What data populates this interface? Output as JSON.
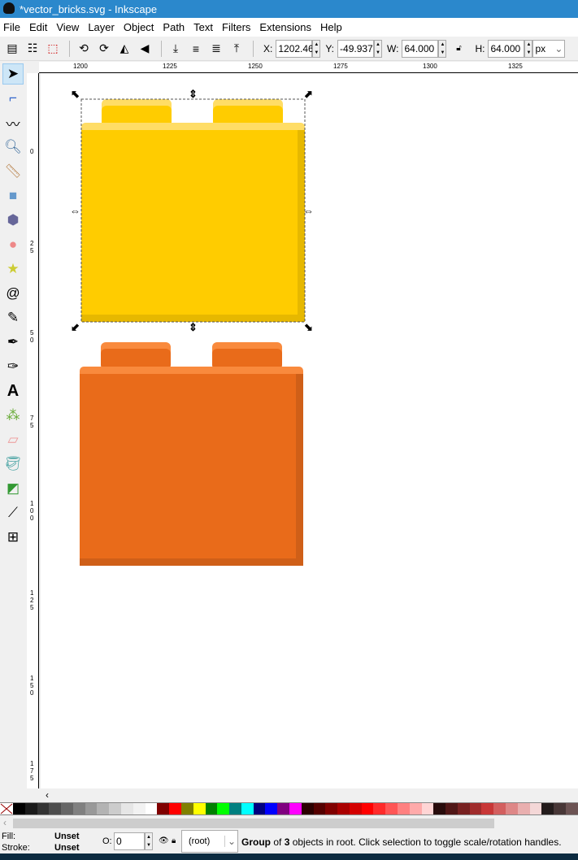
{
  "window": {
    "title": "*vector_bricks.svg - Inkscape"
  },
  "menu": [
    "File",
    "Edit",
    "View",
    "Layer",
    "Object",
    "Path",
    "Text",
    "Filters",
    "Extensions",
    "Help"
  ],
  "toolbar": {
    "x_label": "X:",
    "x": "1202.46",
    "y_label": "Y:",
    "y": "-49.937",
    "w_label": "W:",
    "w": "64.000",
    "h_label": "H:",
    "h": "64.000",
    "unit": "px"
  },
  "ruler": {
    "h_ticks": [
      "1200",
      "1225",
      "1250",
      "1275",
      "1300",
      "1325"
    ],
    "v_ticks": [
      "0",
      "2 5",
      "5 0",
      "7 5",
      "1 0 0",
      "1 2 5",
      "1 5 0",
      "1 7 5"
    ]
  },
  "tools": [
    "selector",
    "node",
    "tweak",
    "zoom",
    "measure",
    "rectangle",
    "3d-box",
    "ellipse",
    "star",
    "spiral",
    "pencil",
    "pen",
    "calligraphy",
    "text",
    "spray",
    "eraser",
    "paint-bucket",
    "gradient",
    "dropper",
    "connector"
  ],
  "colors": {
    "yellow": "#ffcc00",
    "yellow_light": "#ffdd66",
    "yellow_dark": "#e6b800",
    "orange": "#e96b1a",
    "orange_light": "#f98a3d",
    "orange_dark": "#cf5f18",
    "accent": "#2b88cc"
  },
  "palette": [
    "#000000",
    "#1a1a1a",
    "#333333",
    "#4d4d4d",
    "#666666",
    "#808080",
    "#999999",
    "#b3b3b3",
    "#cccccc",
    "#e6e6e6",
    "#f2f2f2",
    "#ffffff",
    "#800000",
    "#ff0000",
    "#808000",
    "#ffff00",
    "#008000",
    "#00ff00",
    "#008080",
    "#00ffff",
    "#000080",
    "#0000ff",
    "#800080",
    "#ff00ff",
    "#2b0000",
    "#550000",
    "#800000",
    "#aa0000",
    "#d40000",
    "#ff0000",
    "#ff2a2a",
    "#ff5555",
    "#ff8080",
    "#ffaaaa",
    "#ffd5d5",
    "#280b0b",
    "#501616",
    "#782121",
    "#a02c2c",
    "#c83737",
    "#d35f5f",
    "#de8787",
    "#e9afaf",
    "#f4d7d7",
    "#241c1c",
    "#483737",
    "#6c5353"
  ],
  "status": {
    "fill_label": "Fill:",
    "fill": "Unset",
    "stroke_label": "Stroke:",
    "stroke": "Unset",
    "opacity_label": "O:",
    "opacity": "0",
    "layer": "(root)",
    "msg_bold1": "Group",
    "msg1": " of ",
    "msg_bold2": "3",
    "msg2": " objects in root. Click selection to toggle scale/rotation handles."
  }
}
